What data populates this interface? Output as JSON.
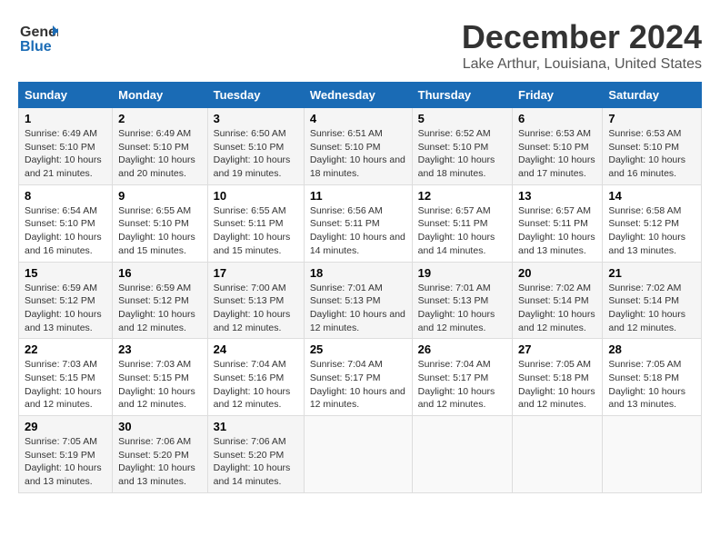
{
  "logo": {
    "line1": "General",
    "line2": "Blue"
  },
  "title": "December 2024",
  "subtitle": "Lake Arthur, Louisiana, United States",
  "days_of_week": [
    "Sunday",
    "Monday",
    "Tuesday",
    "Wednesday",
    "Thursday",
    "Friday",
    "Saturday"
  ],
  "weeks": [
    [
      {
        "day": "1",
        "sunrise": "Sunrise: 6:49 AM",
        "sunset": "Sunset: 5:10 PM",
        "daylight": "Daylight: 10 hours and 21 minutes."
      },
      {
        "day": "2",
        "sunrise": "Sunrise: 6:49 AM",
        "sunset": "Sunset: 5:10 PM",
        "daylight": "Daylight: 10 hours and 20 minutes."
      },
      {
        "day": "3",
        "sunrise": "Sunrise: 6:50 AM",
        "sunset": "Sunset: 5:10 PM",
        "daylight": "Daylight: 10 hours and 19 minutes."
      },
      {
        "day": "4",
        "sunrise": "Sunrise: 6:51 AM",
        "sunset": "Sunset: 5:10 PM",
        "daylight": "Daylight: 10 hours and 18 minutes."
      },
      {
        "day": "5",
        "sunrise": "Sunrise: 6:52 AM",
        "sunset": "Sunset: 5:10 PM",
        "daylight": "Daylight: 10 hours and 18 minutes."
      },
      {
        "day": "6",
        "sunrise": "Sunrise: 6:53 AM",
        "sunset": "Sunset: 5:10 PM",
        "daylight": "Daylight: 10 hours and 17 minutes."
      },
      {
        "day": "7",
        "sunrise": "Sunrise: 6:53 AM",
        "sunset": "Sunset: 5:10 PM",
        "daylight": "Daylight: 10 hours and 16 minutes."
      }
    ],
    [
      {
        "day": "8",
        "sunrise": "Sunrise: 6:54 AM",
        "sunset": "Sunset: 5:10 PM",
        "daylight": "Daylight: 10 hours and 16 minutes."
      },
      {
        "day": "9",
        "sunrise": "Sunrise: 6:55 AM",
        "sunset": "Sunset: 5:10 PM",
        "daylight": "Daylight: 10 hours and 15 minutes."
      },
      {
        "day": "10",
        "sunrise": "Sunrise: 6:55 AM",
        "sunset": "Sunset: 5:11 PM",
        "daylight": "Daylight: 10 hours and 15 minutes."
      },
      {
        "day": "11",
        "sunrise": "Sunrise: 6:56 AM",
        "sunset": "Sunset: 5:11 PM",
        "daylight": "Daylight: 10 hours and 14 minutes."
      },
      {
        "day": "12",
        "sunrise": "Sunrise: 6:57 AM",
        "sunset": "Sunset: 5:11 PM",
        "daylight": "Daylight: 10 hours and 14 minutes."
      },
      {
        "day": "13",
        "sunrise": "Sunrise: 6:57 AM",
        "sunset": "Sunset: 5:11 PM",
        "daylight": "Daylight: 10 hours and 13 minutes."
      },
      {
        "day": "14",
        "sunrise": "Sunrise: 6:58 AM",
        "sunset": "Sunset: 5:12 PM",
        "daylight": "Daylight: 10 hours and 13 minutes."
      }
    ],
    [
      {
        "day": "15",
        "sunrise": "Sunrise: 6:59 AM",
        "sunset": "Sunset: 5:12 PM",
        "daylight": "Daylight: 10 hours and 13 minutes."
      },
      {
        "day": "16",
        "sunrise": "Sunrise: 6:59 AM",
        "sunset": "Sunset: 5:12 PM",
        "daylight": "Daylight: 10 hours and 12 minutes."
      },
      {
        "day": "17",
        "sunrise": "Sunrise: 7:00 AM",
        "sunset": "Sunset: 5:13 PM",
        "daylight": "Daylight: 10 hours and 12 minutes."
      },
      {
        "day": "18",
        "sunrise": "Sunrise: 7:01 AM",
        "sunset": "Sunset: 5:13 PM",
        "daylight": "Daylight: 10 hours and 12 minutes."
      },
      {
        "day": "19",
        "sunrise": "Sunrise: 7:01 AM",
        "sunset": "Sunset: 5:13 PM",
        "daylight": "Daylight: 10 hours and 12 minutes."
      },
      {
        "day": "20",
        "sunrise": "Sunrise: 7:02 AM",
        "sunset": "Sunset: 5:14 PM",
        "daylight": "Daylight: 10 hours and 12 minutes."
      },
      {
        "day": "21",
        "sunrise": "Sunrise: 7:02 AM",
        "sunset": "Sunset: 5:14 PM",
        "daylight": "Daylight: 10 hours and 12 minutes."
      }
    ],
    [
      {
        "day": "22",
        "sunrise": "Sunrise: 7:03 AM",
        "sunset": "Sunset: 5:15 PM",
        "daylight": "Daylight: 10 hours and 12 minutes."
      },
      {
        "day": "23",
        "sunrise": "Sunrise: 7:03 AM",
        "sunset": "Sunset: 5:15 PM",
        "daylight": "Daylight: 10 hours and 12 minutes."
      },
      {
        "day": "24",
        "sunrise": "Sunrise: 7:04 AM",
        "sunset": "Sunset: 5:16 PM",
        "daylight": "Daylight: 10 hours and 12 minutes."
      },
      {
        "day": "25",
        "sunrise": "Sunrise: 7:04 AM",
        "sunset": "Sunset: 5:17 PM",
        "daylight": "Daylight: 10 hours and 12 minutes."
      },
      {
        "day": "26",
        "sunrise": "Sunrise: 7:04 AM",
        "sunset": "Sunset: 5:17 PM",
        "daylight": "Daylight: 10 hours and 12 minutes."
      },
      {
        "day": "27",
        "sunrise": "Sunrise: 7:05 AM",
        "sunset": "Sunset: 5:18 PM",
        "daylight": "Daylight: 10 hours and 12 minutes."
      },
      {
        "day": "28",
        "sunrise": "Sunrise: 7:05 AM",
        "sunset": "Sunset: 5:18 PM",
        "daylight": "Daylight: 10 hours and 13 minutes."
      }
    ],
    [
      {
        "day": "29",
        "sunrise": "Sunrise: 7:05 AM",
        "sunset": "Sunset: 5:19 PM",
        "daylight": "Daylight: 10 hours and 13 minutes."
      },
      {
        "day": "30",
        "sunrise": "Sunrise: 7:06 AM",
        "sunset": "Sunset: 5:20 PM",
        "daylight": "Daylight: 10 hours and 13 minutes."
      },
      {
        "day": "31",
        "sunrise": "Sunrise: 7:06 AM",
        "sunset": "Sunset: 5:20 PM",
        "daylight": "Daylight: 10 hours and 14 minutes."
      },
      null,
      null,
      null,
      null
    ]
  ]
}
